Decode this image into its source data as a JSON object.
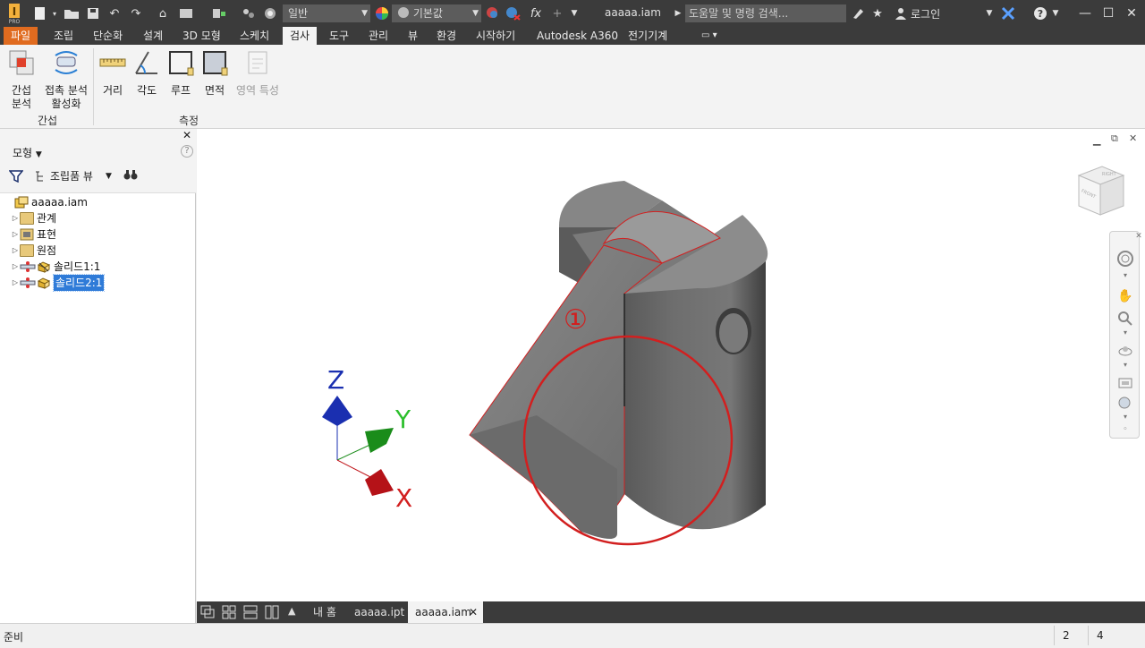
{
  "app": {
    "title": "aaaaa.iam",
    "search_placeholder": "도움말 및 명령 검색...",
    "login_label": "로그인",
    "style_combo": "일반",
    "material_combo": "기본값",
    "fx_label": "fx",
    "help_icon": "?"
  },
  "menu_tabs": [
    {
      "label": "파일"
    },
    {
      "label": "조립"
    },
    {
      "label": "단순화"
    },
    {
      "label": "설계"
    },
    {
      "label": "3D 모형"
    },
    {
      "label": "스케치"
    },
    {
      "label": "검사"
    },
    {
      "label": "도구"
    },
    {
      "label": "관리"
    },
    {
      "label": "뷰"
    },
    {
      "label": "환경"
    },
    {
      "label": "시작하기"
    },
    {
      "label": "Autodesk A360"
    },
    {
      "label": "전기기계"
    }
  ],
  "ribbon": {
    "interference": {
      "line1": "간섭",
      "line2": "분석"
    },
    "contact": {
      "line1": "접촉 분석",
      "line2": "활성화"
    },
    "distance": "거리",
    "angle": "각도",
    "loop": "루프",
    "area": "면적",
    "region": "영역 특성",
    "group_interference": "간섭",
    "group_measure": "측정"
  },
  "browser": {
    "title": "모형",
    "view_label": "조립품 뷰",
    "help": "?",
    "close": "✕",
    "tree": [
      {
        "label": "aaaaa.iam"
      },
      {
        "label": "관계"
      },
      {
        "label": "표현"
      },
      {
        "label": "원점"
      },
      {
        "label": "솔리드1:1"
      },
      {
        "label": "솔리드2:1"
      }
    ]
  },
  "viewport": {
    "annotation": "①",
    "axis_z": "Z",
    "axis_y": "Y",
    "axis_x": "X",
    "viewcube_top": "RIGHT",
    "viewcube_front": "FRONT",
    "colors": {
      "body": "#6f6f6f",
      "highlight": "#d21f1f",
      "axis_x": "#c0161b",
      "axis_y": "#1a8c1a",
      "axis_z": "#1a2fb0"
    }
  },
  "doc_tabs": {
    "home": "내 홈",
    "ipt": "aaaaa.ipt",
    "iam": "aaaaa.iam",
    "close": "✕"
  },
  "status": {
    "text": "준비",
    "count_a": "2",
    "count_b": "4"
  }
}
